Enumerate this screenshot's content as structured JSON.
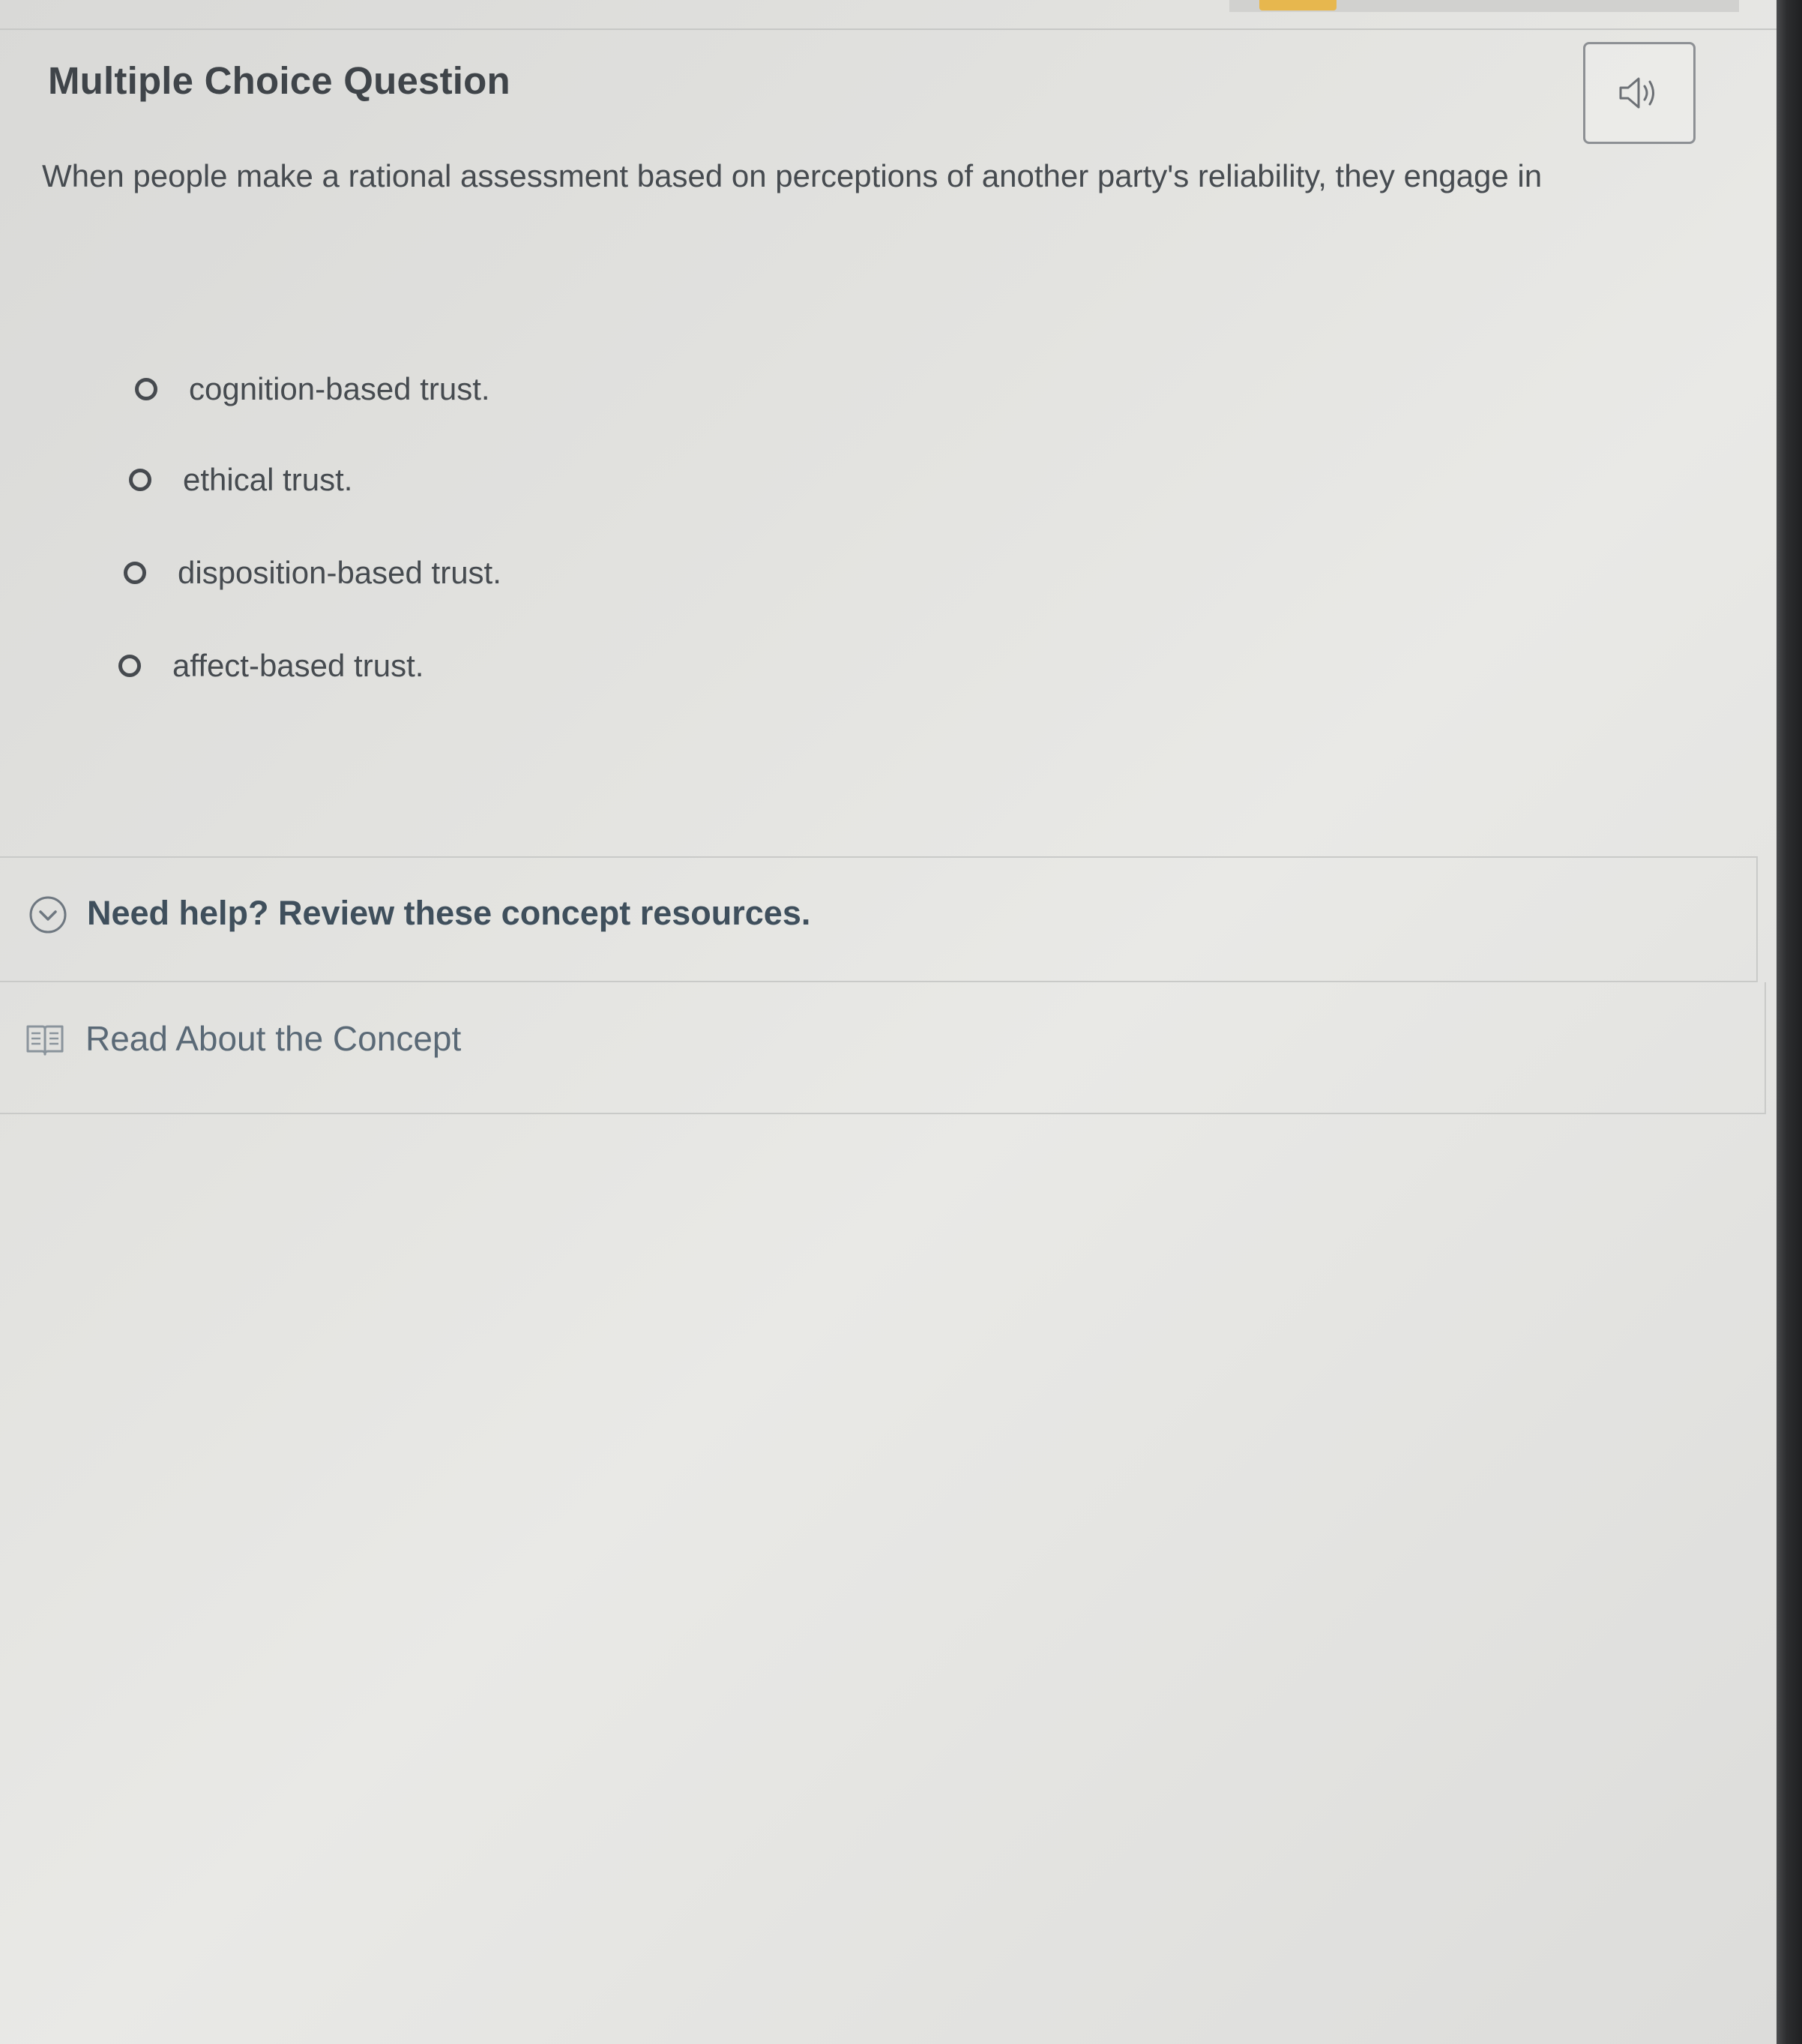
{
  "question": {
    "type_label": "Multiple Choice Question",
    "prompt": "When people make a rational assessment based on perceptions of another party's reliability, they engage in"
  },
  "toolbar": {
    "audio_icon": "speaker-icon"
  },
  "options": [
    {
      "label": "cognition-based trust.",
      "selected": false
    },
    {
      "label": "ethical trust.",
      "selected": false
    },
    {
      "label": "disposition-based trust.",
      "selected": false
    },
    {
      "label": "affect-based trust.",
      "selected": false
    }
  ],
  "help": {
    "title": "Need help? Review these concept resources.",
    "toggle_icon": "chevron-down-circle-icon",
    "resources": [
      {
        "label": "Read About the Concept",
        "icon": "book-icon"
      }
    ]
  },
  "colors": {
    "accent": "#e7b74e",
    "text": "#464b50",
    "help_title": "#3f4f5c",
    "resource_text": "#5a6976"
  }
}
